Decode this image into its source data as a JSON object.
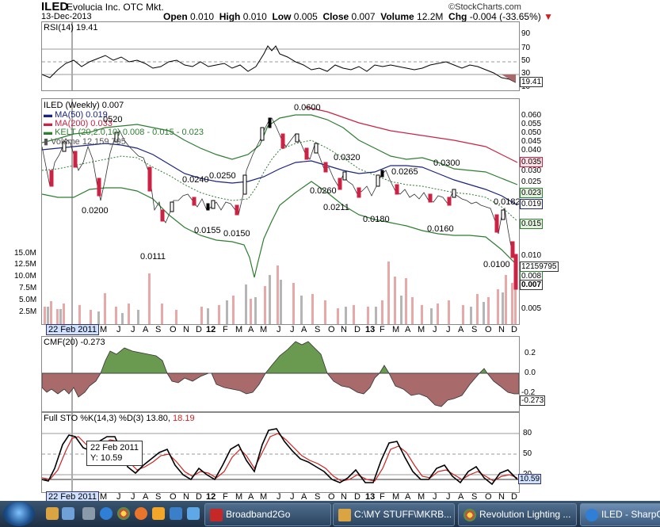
{
  "header": {
    "symbol": "ILED",
    "company": "Evolucia Inc.",
    "market": "OTC Mkt.",
    "date": "13-Dec-2013",
    "open_label": "Open",
    "open": "0.010",
    "high_label": "High",
    "high": "0.010",
    "low_label": "Low",
    "low": "0.005",
    "close_label": "Close",
    "close": "0.007",
    "volume_label": "Volume",
    "volume": "12.2M",
    "chg_label": "Chg",
    "chg": "-0.004 (-33.65%)",
    "copyright": "©StockCharts.com"
  },
  "rsi": {
    "label": "RSI(14) 19.41",
    "ticks": [
      "90",
      "70",
      "50",
      "30",
      "10"
    ],
    "tag": "19.41"
  },
  "price": {
    "legend": {
      "main": "ILED (Weekly) 0.007",
      "ma50": "MA(50) 0.019",
      "ma200": "MA(200) 0.033",
      "kelt": "KELT (20,2.0,10) 0.008 - 0.015 - 0.023",
      "volume": "Volume 12,159,795",
      "partial": "0520"
    },
    "annotations": [
      "0.0600",
      "0.0200",
      "0.0111",
      "0.0240",
      "0.0250",
      "0.0155",
      "0.0150",
      "0.0260",
      "0.0320",
      "0.0211",
      "0.0265",
      "0.0180",
      "0.0300",
      "0.0160",
      "0.0182",
      "0.0100"
    ],
    "right_ticks": [
      "0.060",
      "0.055",
      "0.050",
      "0.045",
      "0.040",
      "0.035",
      "0.030",
      "0.025",
      "0.020",
      "0.015",
      "0.010",
      "0.005"
    ],
    "left_vol_ticks": [
      "15.0M",
      "12.5M",
      "10.0M",
      "7.5M",
      "5.0M",
      "2.5M"
    ],
    "tags": {
      "ma200": "0.035",
      "kelt_upper": "0.023",
      "ma50": "0.019",
      "kelt_mid": "0.015",
      "volume": "12159795",
      "kelt_lower": "0.008",
      "close": "0.007"
    }
  },
  "xaxis": {
    "labels": [
      "M",
      "J",
      "J",
      "A",
      "S",
      "O",
      "N",
      "D",
      "12",
      "F",
      "M",
      "A",
      "M",
      "J",
      "J",
      "A",
      "S",
      "O",
      "N",
      "D",
      "13",
      "F",
      "M",
      "A",
      "M",
      "J",
      "J",
      "A",
      "S",
      "O",
      "N",
      "D"
    ],
    "cursor_date": "22 Feb 2011"
  },
  "cmf": {
    "label": "CMF(20) -0.273",
    "ticks": [
      "0.2",
      "0.0",
      "-0.2"
    ],
    "tag": "-0.273"
  },
  "sto": {
    "label_main": "Full STO %K(14,3) %D(3) 13.80,",
    "label_d": "18.19",
    "ticks": [
      "80",
      "50",
      "20"
    ],
    "tag": "10.59",
    "tooltip_date": "22 Feb 2011",
    "tooltip_value": "Y: 10.59"
  },
  "taskbar": {
    "items": [
      {
        "label": "Broadband2Go"
      },
      {
        "label": "C:\\MY STUFF\\MKRB..."
      },
      {
        "label": "Revolution Lighting ..."
      },
      {
        "label": "ILED - SharpC"
      }
    ]
  },
  "colors": {
    "ma50": "#1a237e",
    "ma200": "#cc2244",
    "kelt": "#2e7d32",
    "candle_down": "#cc2244",
    "cmf_pos": "#6a9a50",
    "cmf_neg": "#a86a6a",
    "sto_k": "#000000",
    "sto_d": "#cc2222"
  }
}
